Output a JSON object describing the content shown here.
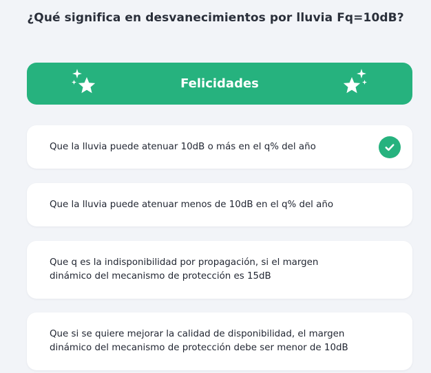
{
  "question": {
    "title": "¿Qué significa en desvanecimientos por lluvia Fq=10dB?"
  },
  "result": {
    "label": "Felicidades",
    "icon": "sparkle-star-icon"
  },
  "options": [
    {
      "text": "Que la lluvia puede atenuar 10dB o más en el q% del año",
      "selected": true,
      "correct": true
    },
    {
      "text": "Que la lluvia puede atenuar menos de 10dB en el q% del año",
      "selected": false
    },
    {
      "text": "Que q es la indisponibilidad por propagación, si el margen dinámico del mecanismo de protección es 15dB",
      "selected": false
    },
    {
      "text": "Que si se quiere mejorar la calidad de disponibilidad, el margen dinámico del mecanismo de protección debe ser menor de 10dB",
      "selected": false
    }
  ],
  "colors": {
    "accent": "#26b27e",
    "background": "#f2f4f8",
    "card": "#ffffff",
    "text": "#1f2430"
  }
}
